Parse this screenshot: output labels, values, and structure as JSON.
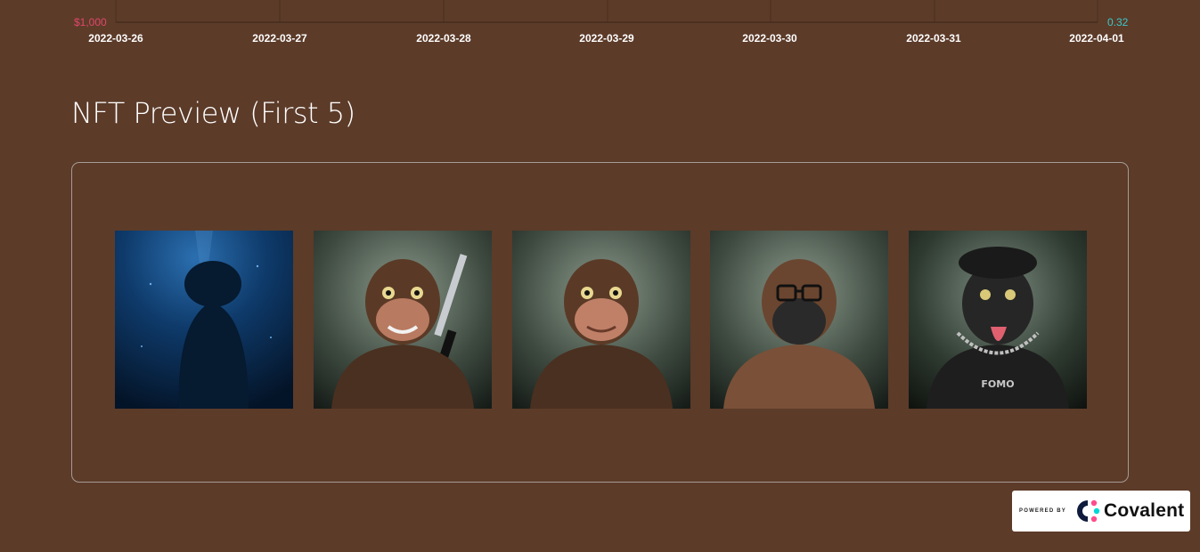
{
  "chart": {
    "left_axis_label": "$1,000",
    "right_axis_label": "0.32",
    "x_ticks": [
      "2022-03-26",
      "2022-03-27",
      "2022-03-28",
      "2022-03-29",
      "2022-03-30",
      "2022-03-31",
      "2022-04-01"
    ]
  },
  "section": {
    "title": "NFT Preview (First 5)"
  },
  "nfts": [
    {
      "icon": "diver-silhouette-image"
    },
    {
      "icon": "ape-with-katana-image"
    },
    {
      "icon": "ape-smiling-image"
    },
    {
      "icon": "ape-with-glasses-image"
    },
    {
      "icon": "ape-with-beret-chain-image",
      "chain_text": "FOMO"
    }
  ],
  "badge": {
    "powered_by": "POWERED BY",
    "brand": "Covalent"
  },
  "colors": {
    "background": "#5c3b29",
    "left_axis": "#e0476a",
    "right_axis": "#3cc8c8"
  }
}
